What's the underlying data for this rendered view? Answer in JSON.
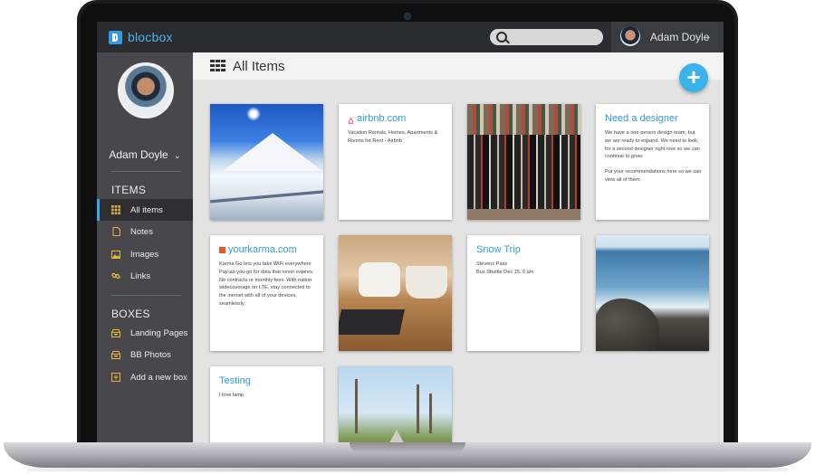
{
  "app": {
    "brand": "blocbox",
    "search": {
      "placeholder": ""
    },
    "user": {
      "name": "Adam Doyle",
      "chevron": "⌄"
    }
  },
  "sidebar": {
    "profile_name": "Adam Doyle",
    "profile_chevron": "⌄",
    "items_title": "ITEMS",
    "items": [
      {
        "label": "All items",
        "icon": "grid-icon",
        "active": true
      },
      {
        "label": "Notes",
        "icon": "note-icon"
      },
      {
        "label": "Images",
        "icon": "image-icon"
      },
      {
        "label": "Links",
        "icon": "link-icon"
      }
    ],
    "boxes_title": "BOXES",
    "boxes": [
      {
        "label": "Landing Pages",
        "icon": "box-icon"
      },
      {
        "label": "BB Photos",
        "icon": "box-icon"
      },
      {
        "label": "Add a new box",
        "icon": "add-box-icon"
      }
    ]
  },
  "main": {
    "title": "All Items",
    "add_label": "+",
    "cards": [
      {
        "type": "image",
        "subject": "snowy mountain"
      },
      {
        "type": "link",
        "title": "airbnb.com",
        "icon": "airbnb-icon",
        "body": "Vacation Rentals, Homes, Apartments & Rooms for Rent - Airbnb"
      },
      {
        "type": "image",
        "subject": "snowboards on wall"
      },
      {
        "type": "note",
        "title": "Need a designer",
        "body1": "We have a one-person design team, but we are ready to expand. We need to look for a second designer right now so we can continue to grow.",
        "body2": "Put your recommendations here so we can view all of them."
      },
      {
        "type": "link",
        "title": "yourkarma.com",
        "icon": "karma-icon",
        "body": "Karma Go lets you take WiFi everywhere Pay-as-you-go for data that never expires. No contracts or monthly fees. With nation widecoverage on LTE, stay connected to the inernet with all of your devices, seamlessly."
      },
      {
        "type": "image",
        "subject": "coffee cup and laptop"
      },
      {
        "type": "note",
        "title": "Snow Trip",
        "body1": "Stevens Pass",
        "body2": "Bus Shuttle Dec 15, 6 am"
      },
      {
        "type": "image",
        "subject": "rocky coastline"
      },
      {
        "type": "note",
        "title": "Testing",
        "body1": "I love lamp"
      },
      {
        "type": "image",
        "subject": "palm tree road"
      }
    ]
  },
  "colors": {
    "accent": "#2f9be0",
    "topbar": "#2b2c2f",
    "sidebar": "#48484c",
    "icon_yellow": "#e7b43b",
    "fab": "#39b3ea"
  }
}
